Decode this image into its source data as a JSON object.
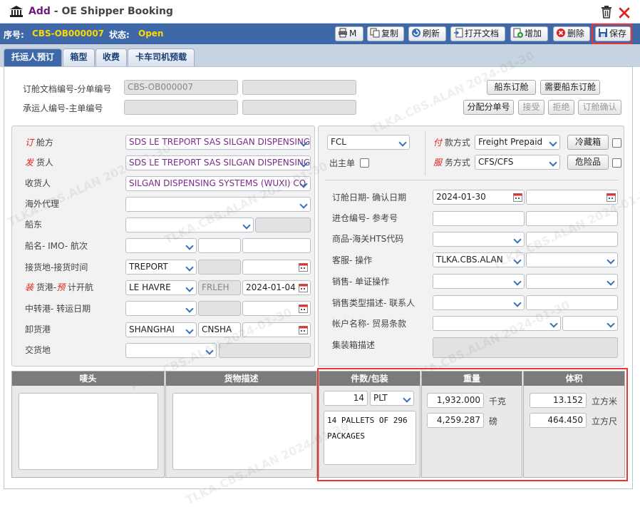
{
  "window": {
    "title_add": "Add",
    "title_rest": " - OE Shipper Booking"
  },
  "info": {
    "seq_label": "序号:",
    "seq_value": "CBS-OB000007",
    "status_label": "状态:",
    "status_value": "Open"
  },
  "toolbar": {
    "print": "M",
    "copy": "复制",
    "refresh": "刷新",
    "open_doc": "打开文档",
    "add": "增加",
    "delete": "删除",
    "save": "保存"
  },
  "tabs": [
    "托运人预订",
    "箱型",
    "收费",
    "卡车司机预载"
  ],
  "top": {
    "booking_label": "订舱文档编号-分单编号",
    "booking_no": "CBS-OB000007",
    "shipper_label": "承运人编号-主单编号",
    "btn_carrier_booking": "船东订舱",
    "btn_need_booking": "需要船东订舱",
    "btn_assign": "分配分单号",
    "btn_accept": "接受",
    "btn_reject": "拒绝",
    "btn_confirm": "订舱确认"
  },
  "left": {
    "booker_red": "订",
    "booker_label": "舱方",
    "booker_value": "SDS LE TREPORT SAS SILGAN DISPENSING",
    "shipper_red": "发",
    "shipper_label": "货人",
    "shipper_value": "SDS LE TREPORT SAS SILGAN DISPENSING",
    "consignee_label": "收货人",
    "consignee_value": "SILGAN DISPENSING SYSTEMS (WUXI) CO",
    "agent_label": "海外代理",
    "carrier_label": "船东",
    "vessel_label": "船名- IMO- 航次",
    "receipt_label": "接货地-接货时间",
    "receipt_value": "TREPORT",
    "load_red": "装",
    "load_label": "货港-",
    "load_red2": "预",
    "load_label2": "计开航",
    "load_port": "LE HAVRE",
    "load_code": "FRLEH",
    "etd": "2024-01-04",
    "transit_label": "中转港- 转运日期",
    "discharge_label": "卸货港",
    "discharge_port": "SHANGHAI",
    "discharge_code": "CNSHA",
    "delivery_label": "交货地"
  },
  "right": {
    "load_type": "FCL",
    "master_label": "出主单",
    "pay_red": "付",
    "pay_label": "款方式",
    "pay_value": "Freight Prepaid",
    "service_red": "服",
    "service_label": "务方式",
    "service_value": "CFS/CFS",
    "reefer_btn": "冷藏箱",
    "dg_btn": "危险品",
    "booking_date_label": "订舱日期- 确认日期",
    "booking_date": "2024-01-30",
    "ref_label": "进仓编号- 参考号",
    "hts_label": "商品-海关HTS代码",
    "cs_label": "客服- 操作",
    "cs_value": "TLKA.CBS.ALAN",
    "sales_label": "销售- 单证操作",
    "sales_type_label": "销售类型描述- 联系人",
    "account_label": "帐户名称- 贸易条款",
    "container_label": "集装箱描述"
  },
  "bottom": {
    "marks_label": "唛头",
    "goods_label": "货物描述",
    "pkgs_label": "件数/包装",
    "pkgs_count": "14",
    "pkgs_unit": "PLT",
    "pkgs_desc": "14 PALLETS OF 296\nPACKAGES",
    "weight_label": "重量",
    "weight_kg": "1,932.000",
    "kg_unit": "千克",
    "weight_lb": "4,259.287",
    "lb_unit": "磅",
    "volume_label": "体积",
    "volume_cbm": "13.152",
    "cbm_unit": "立方米",
    "volume_cft": "464.450",
    "cft_unit": "立方尺"
  },
  "watermark": "TLKA.CBS.ALAN 2024-01-30",
  "colors": {
    "infobar": "#3e68a8",
    "accent_yellow": "#ffd700",
    "status_green": "#ffd700",
    "highlight_red": "#e33333",
    "purple_text": "#7a2b8a"
  }
}
